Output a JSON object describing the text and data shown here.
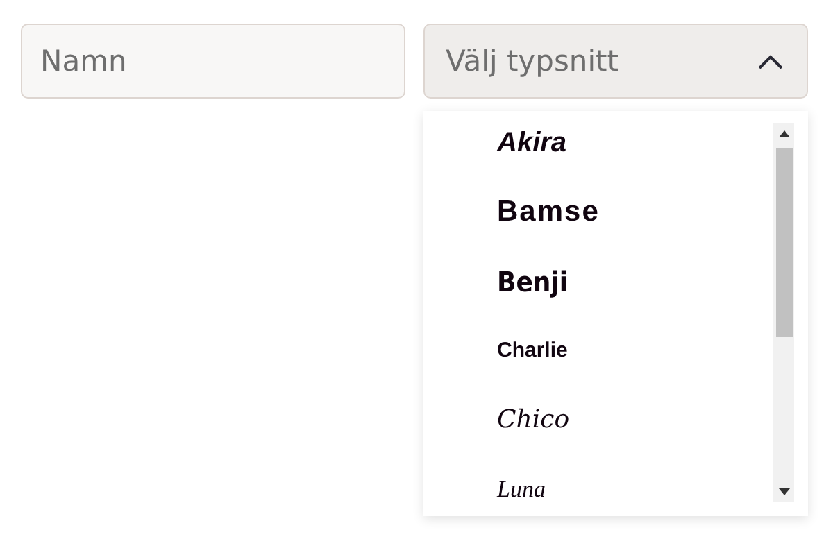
{
  "name_field": {
    "placeholder": "Namn"
  },
  "font_select": {
    "placeholder": "Välj typsnitt",
    "expanded": true
  },
  "font_options": [
    {
      "label": "Akira",
      "kind": "brush"
    },
    {
      "label": "Bamse",
      "kind": "caps"
    },
    {
      "label": "Benji",
      "kind": "heavy"
    },
    {
      "label": "Charlie",
      "kind": "small"
    },
    {
      "label": "Chico",
      "kind": "script"
    },
    {
      "label": "Luna",
      "kind": "thin"
    }
  ]
}
